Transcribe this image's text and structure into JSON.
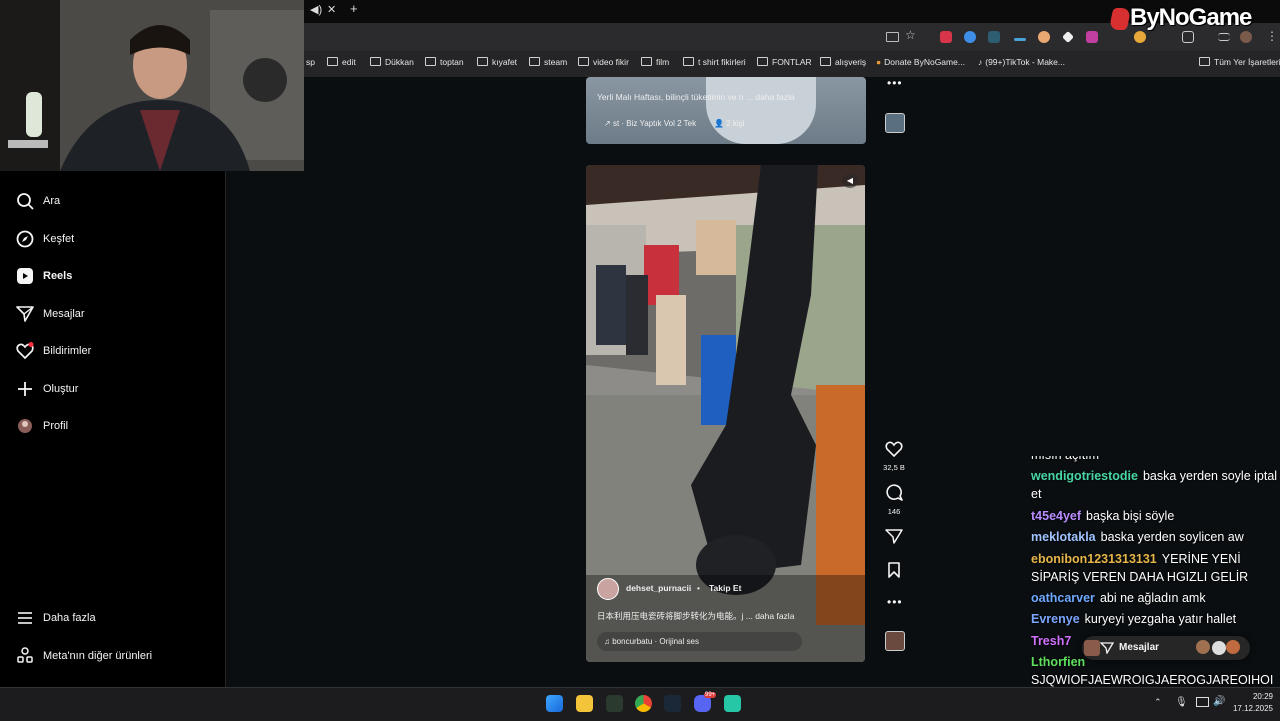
{
  "browser": {
    "bookmarks": [
      "sp",
      "edit",
      "Dükkan",
      "toptan",
      "kıyafet",
      "steam",
      "video fikir",
      "film",
      "t shirt fikirleri",
      "FONTLAR",
      "alışveriş",
      "Donate ByNoGame...",
      "(99+)TikTok - Make...",
      "Tüm Yer İşaretleri"
    ]
  },
  "overlay": {
    "logo": "ByNoGame"
  },
  "sidebar": {
    "items": [
      {
        "label": "Ara",
        "icon": "search-icon"
      },
      {
        "label": "Keşfet",
        "icon": "compass-icon"
      },
      {
        "label": "Reels",
        "icon": "reels-icon"
      },
      {
        "label": "Mesajlar",
        "icon": "send-icon"
      },
      {
        "label": "Bildirimler",
        "icon": "heart-icon"
      },
      {
        "label": "Oluştur",
        "icon": "plus-icon"
      },
      {
        "label": "Profil",
        "icon": "avatar-icon"
      }
    ],
    "bottom": [
      {
        "label": "Daha fazla",
        "icon": "menu-icon"
      },
      {
        "label": "Meta'nın diğer ürünleri",
        "icon": "meta-icon"
      }
    ]
  },
  "reel_prev": {
    "caption": "Yerli Malı Haftası, bilinçli tüketimin ve n ... daha fazla",
    "audio": "st · Biz Yaptık Vol 2  Tek",
    "people": "2 kişi"
  },
  "reel": {
    "username": "dehset_purnacii",
    "dot": "•",
    "follow": "Takip Et",
    "caption": "日本利用压电瓷砖将脚步转化为电能。j ... daha fazla",
    "audio": "boncurbatu · Orijinal ses",
    "likes": "32,5 B",
    "comments": "146"
  },
  "chat": {
    "partial": "mısın açıtım",
    "messages": [
      {
        "user": "wendigotriestodie",
        "color": "#49d6a6",
        "text": "baska yerden soyle iptal et"
      },
      {
        "user": "t45e4yef",
        "color": "#b98cff",
        "text": "başka bişi söyle"
      },
      {
        "user": "meklotakla",
        "color": "#9ec3ff",
        "text": "baska yerden soylicen aw"
      },
      {
        "user": "ebonibon1231313131",
        "color": "#e7b64a",
        "text": "YERİNE YENİ SİPARİŞ VEREN DAHA HGIZLI GELİR"
      },
      {
        "user": "oathcarver",
        "color": "#6fa8ff",
        "text": "abi ne ağladın amk"
      },
      {
        "user": "Evrenye",
        "color": "#7aa6ff",
        "text": "kuryeyi yezgaha yatır hallet"
      },
      {
        "user": "Tresh7",
        "color": "#d070ff",
        "text": ""
      },
      {
        "user": "Lthorfien",
        "color": "#5ee05e",
        "text": "SJQWIOFJAEWROIGJAEROGJAREOIHOIAERJH"
      }
    ]
  },
  "messages_pill": {
    "label": "Mesajlar"
  },
  "taskbar": {
    "time": "20:29",
    "date": "17.12.2025",
    "badge": "99+"
  }
}
